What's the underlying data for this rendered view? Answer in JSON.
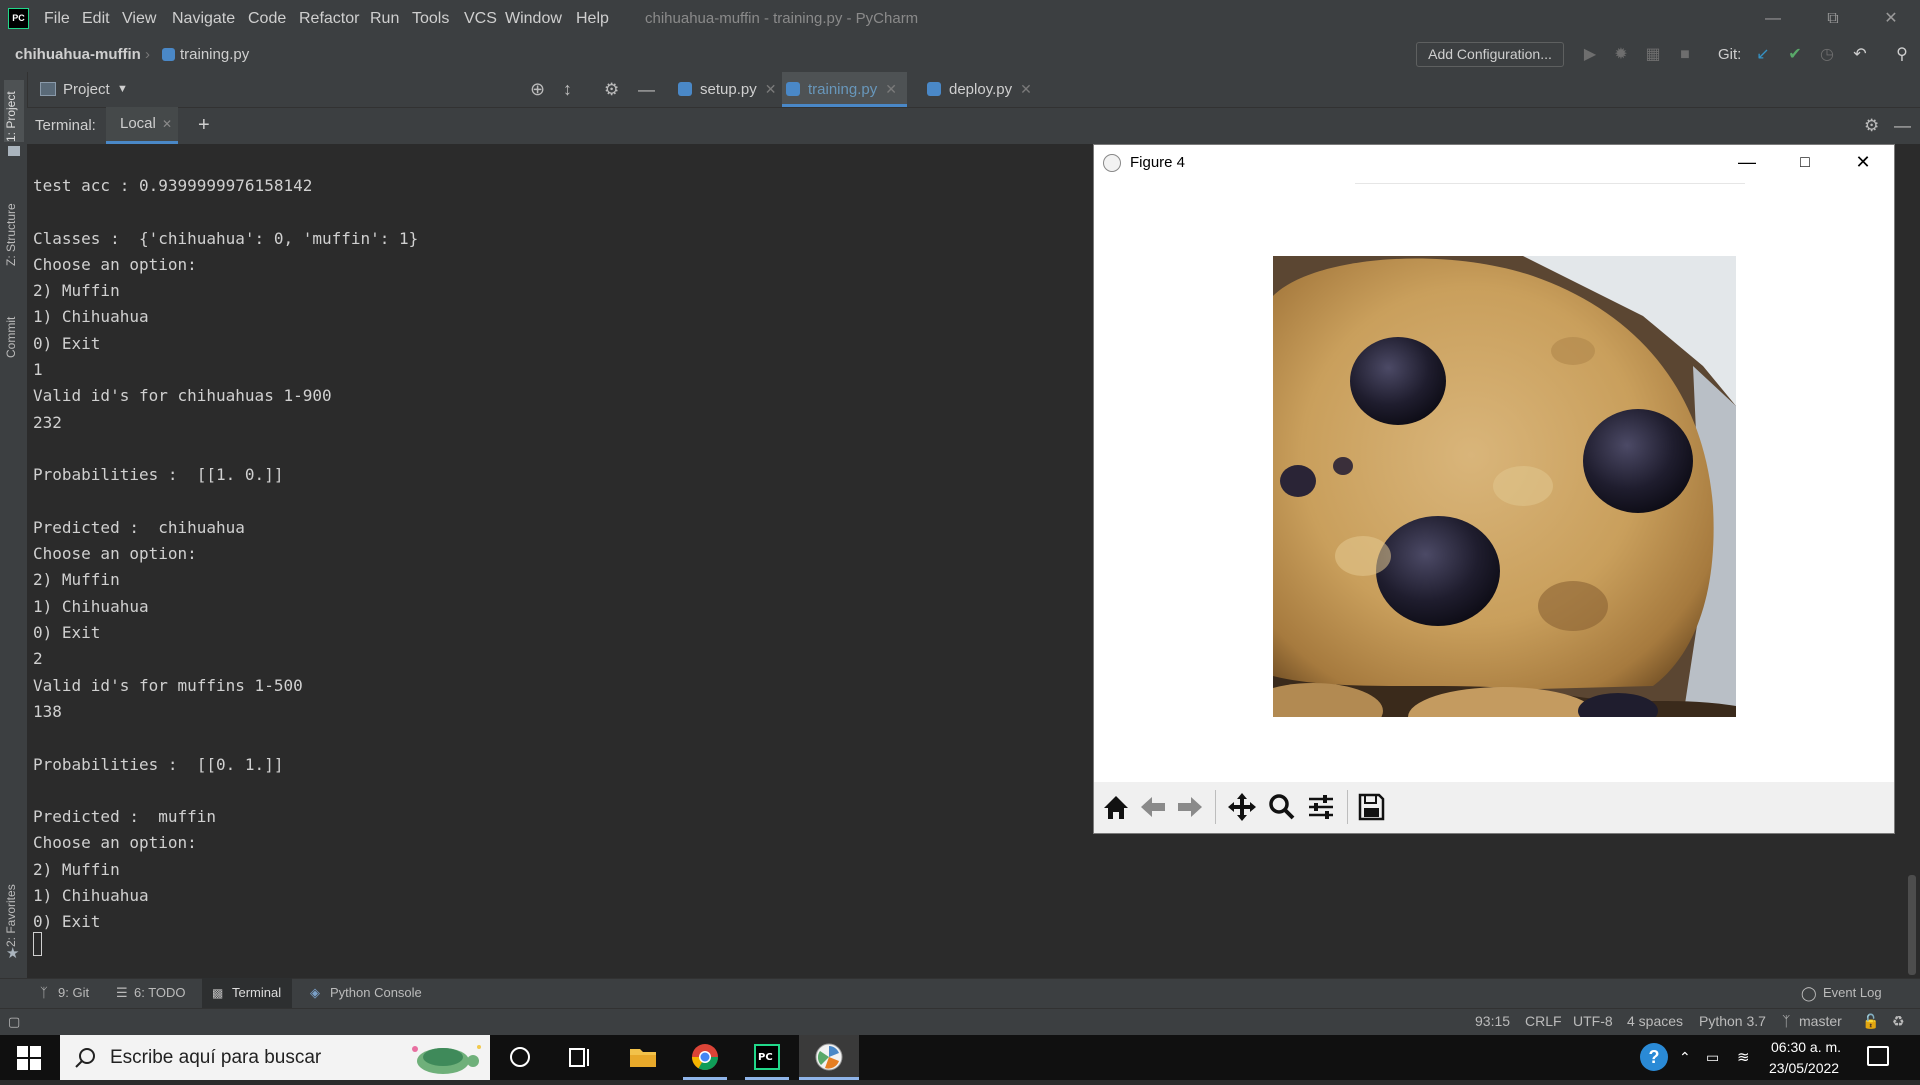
{
  "window": {
    "title": "chihuahua-muffin - training.py - PyCharm",
    "logo_text": "PC",
    "menu": [
      "File",
      "Edit",
      "View",
      "Navigate",
      "Code",
      "Refactor",
      "Run",
      "Tools",
      "VCS",
      "Window",
      "Help"
    ]
  },
  "navbar": {
    "project": "chihuahua-muffin",
    "file": "training.py",
    "add_configuration": "Add Configuration...",
    "git_label": "Git:"
  },
  "project_panel": {
    "label": "Project"
  },
  "side_labels": {
    "project": "1: Project",
    "structure": "Z: Structure",
    "commit": "Commit",
    "favorites": "2: Favorites"
  },
  "editor_tabs": [
    {
      "label": "setup.py",
      "active": false
    },
    {
      "label": "training.py",
      "active": true
    },
    {
      "label": "deploy.py",
      "active": false
    }
  ],
  "terminal": {
    "header_label": "Terminal:",
    "tab_label": "Local",
    "lines": [
      "test acc : 0.9399999976158142",
      "",
      "Classes :  {'chihuahua': 0, 'muffin': 1}",
      "Choose an option:",
      "2) Muffin",
      "1) Chihuahua",
      "0) Exit",
      "1",
      "Valid id's for chihuahuas 1-900",
      "232",
      "",
      "Probabilities :  [[1. 0.]]",
      "",
      "Predicted :  chihuahua",
      "Choose an option:",
      "2) Muffin",
      "1) Chihuahua",
      "0) Exit",
      "2",
      "Valid id's for muffins 1-500",
      "138",
      "",
      "Probabilities :  [[0. 1.]]",
      "",
      "Predicted :  muffin",
      "Choose an option:",
      "2) Muffin",
      "1) Chihuahua",
      "0) Exit"
    ]
  },
  "figure": {
    "title": "Figure 4"
  },
  "bottom_tabs": [
    "9: Git",
    "6: TODO",
    "Terminal",
    "Python Console"
  ],
  "event_log": "Event Log",
  "status": {
    "position": "93:15",
    "line_sep": "CRLF",
    "encoding": "UTF-8",
    "indent": "4 spaces",
    "interpreter": "Python 3.7",
    "branch": "master"
  },
  "taskbar": {
    "search_placeholder": "Escribe aquí para buscar",
    "time": "06:30 a. m.",
    "date": "23/05/2022"
  },
  "colors": {
    "accent": "#4a88c7",
    "terminal_bg": "#2b2b2b",
    "chrome_bg": "#3c3f41"
  }
}
